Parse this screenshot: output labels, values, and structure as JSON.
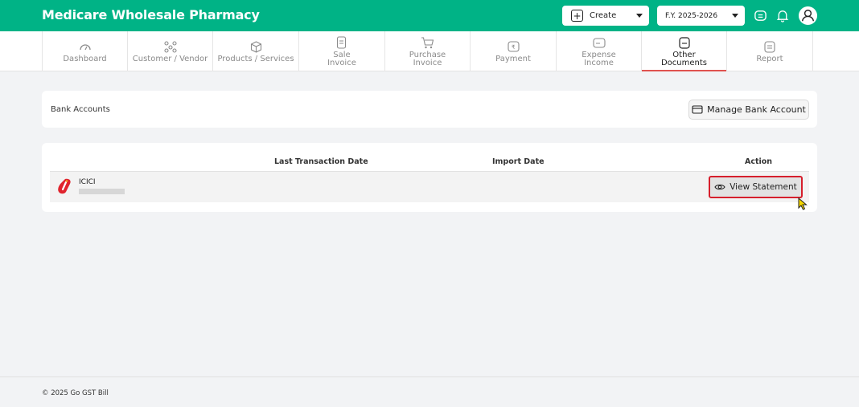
{
  "app": {
    "title": "Medicare Wholesale Pharmacy"
  },
  "header": {
    "create_label": "Create",
    "fy_label": "F.Y. 2025-2026",
    "icons": [
      "message-icon",
      "bell-icon",
      "user-icon"
    ]
  },
  "nav": [
    {
      "line1": "Dashboard",
      "line2": "",
      "icon": "gauge-icon"
    },
    {
      "line1": "Customer / Vendor",
      "line2": "",
      "icon": "people-icon"
    },
    {
      "line1": "Products / Services",
      "line2": "",
      "icon": "box-icon"
    },
    {
      "line1": "Sale",
      "line2": "Invoice",
      "icon": "invoice-icon"
    },
    {
      "line1": "Purchase",
      "line2": "Invoice",
      "icon": "cart-icon"
    },
    {
      "line1": "Payment",
      "line2": "",
      "icon": "payment-icon"
    },
    {
      "line1": "Expense",
      "line2": "Income",
      "icon": "wallet-icon"
    },
    {
      "line1": "Other",
      "line2": "Documents",
      "icon": "documents-icon"
    },
    {
      "line1": "Report",
      "line2": "",
      "icon": "report-icon"
    }
  ],
  "bank_section": {
    "title": "Bank Accounts",
    "manage_label": "Manage Bank Account"
  },
  "table": {
    "columns": [
      "",
      "Last Transaction Date",
      "Import Date",
      "Action"
    ],
    "rows": [
      {
        "bank": "ICICI",
        "last_transaction_date": "",
        "import_date": "",
        "action": "View Statement"
      }
    ]
  },
  "footer": {
    "text": "© 2025 Go GST Bill"
  },
  "colors": {
    "brand": "#00b386",
    "active_underline": "#e0524f",
    "highlight": "#d61f2c",
    "icici": "#e0242d"
  }
}
